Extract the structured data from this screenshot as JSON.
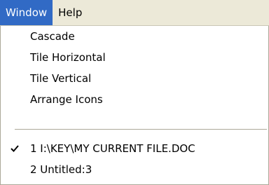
{
  "menubar": {
    "items": [
      {
        "label": "Window",
        "active": true
      },
      {
        "label": "Help",
        "active": false
      }
    ]
  },
  "menu": {
    "items": [
      {
        "label": "Cascade"
      },
      {
        "label": "Tile Horizontal"
      },
      {
        "label": "Tile Vertical"
      },
      {
        "label": "Arrange Icons"
      }
    ],
    "windows": [
      {
        "label": "1 I:\\KEY\\MY CURRENT FILE.DOC",
        "checked": true
      },
      {
        "label": "2 Untitled:3",
        "checked": false
      }
    ]
  },
  "colors": {
    "menubar_bg": "#ece9d8",
    "highlight": "#316ac5",
    "separator": "#aca899"
  },
  "icons": {
    "check": "checkmark-icon"
  }
}
